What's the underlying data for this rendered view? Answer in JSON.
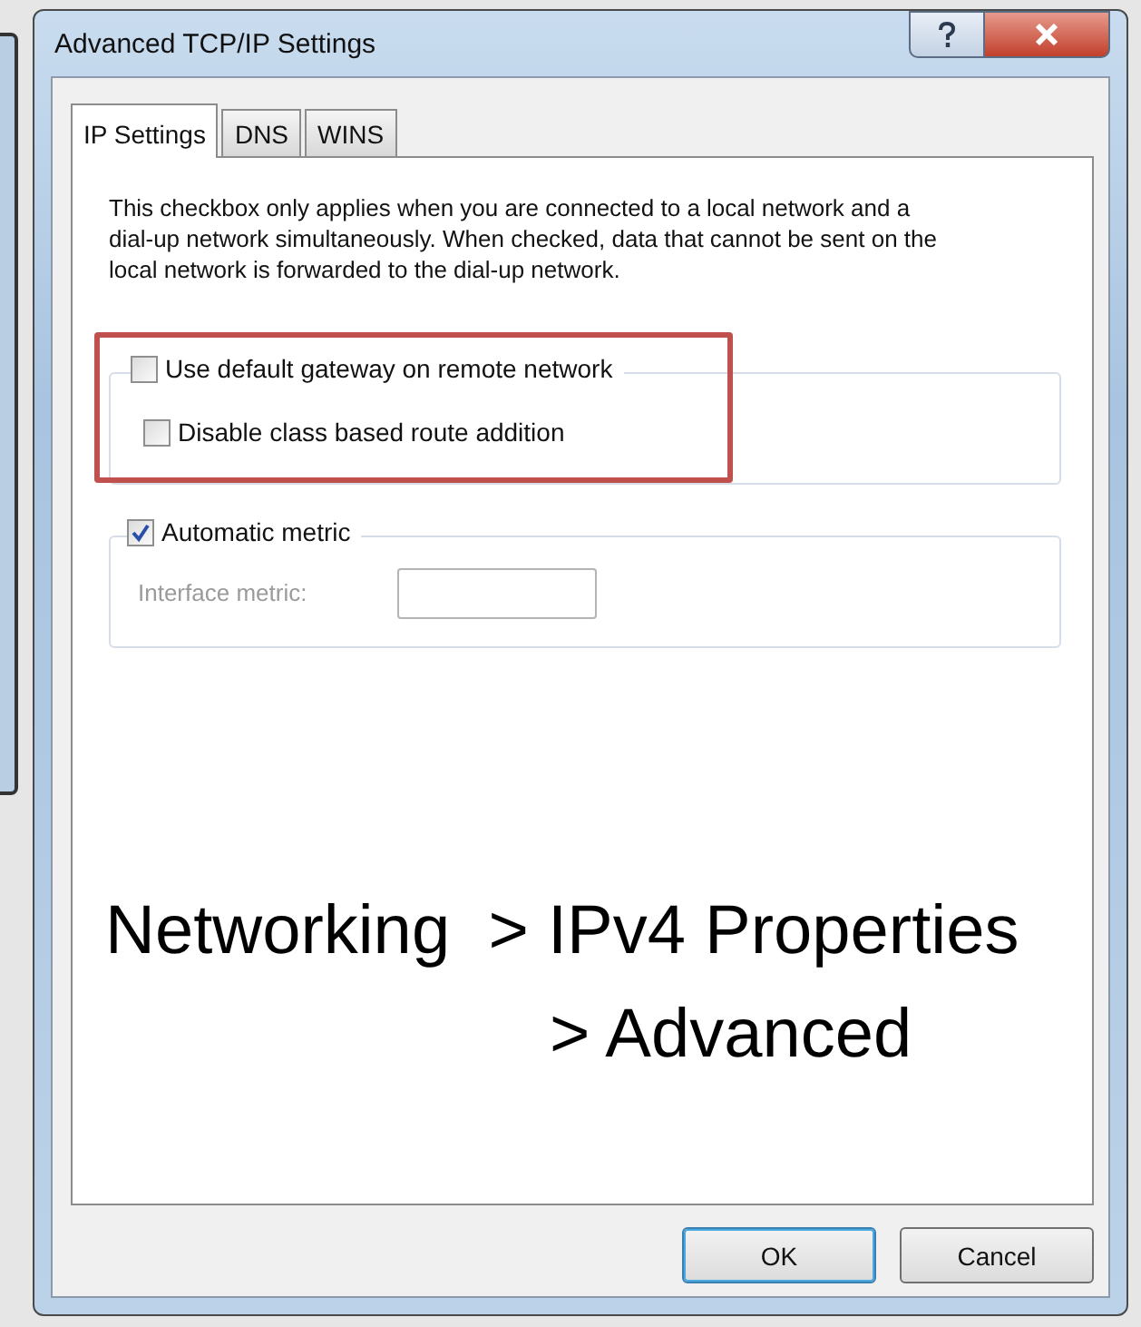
{
  "window": {
    "title": "Advanced TCP/IP Settings"
  },
  "tabs": [
    {
      "label": "IP Settings",
      "selected": true
    },
    {
      "label": "DNS",
      "selected": false
    },
    {
      "label": "WINS",
      "selected": false
    }
  ],
  "description": "This checkbox only applies when you are connected to a local network and a dial-up network simultaneously.  When checked, data that cannot be sent on the local network is forwarded to the dial-up network.",
  "gateway_group": {
    "checkbox": {
      "label": "Use default gateway on remote network",
      "checked": false
    },
    "sub_checkbox": {
      "label": "Disable class based route addition",
      "checked": false
    },
    "highlighted": true
  },
  "metric_group": {
    "checkbox": {
      "label": "Automatic metric",
      "checked": true
    },
    "field": {
      "label": "Interface metric:",
      "disabled": true
    }
  },
  "annotation": [
    "Networking  > IPv4 Properties",
    "> Advanced"
  ],
  "buttons": [
    {
      "label": "OK",
      "default": true
    },
    {
      "label": "Cancel",
      "default": false
    }
  ]
}
